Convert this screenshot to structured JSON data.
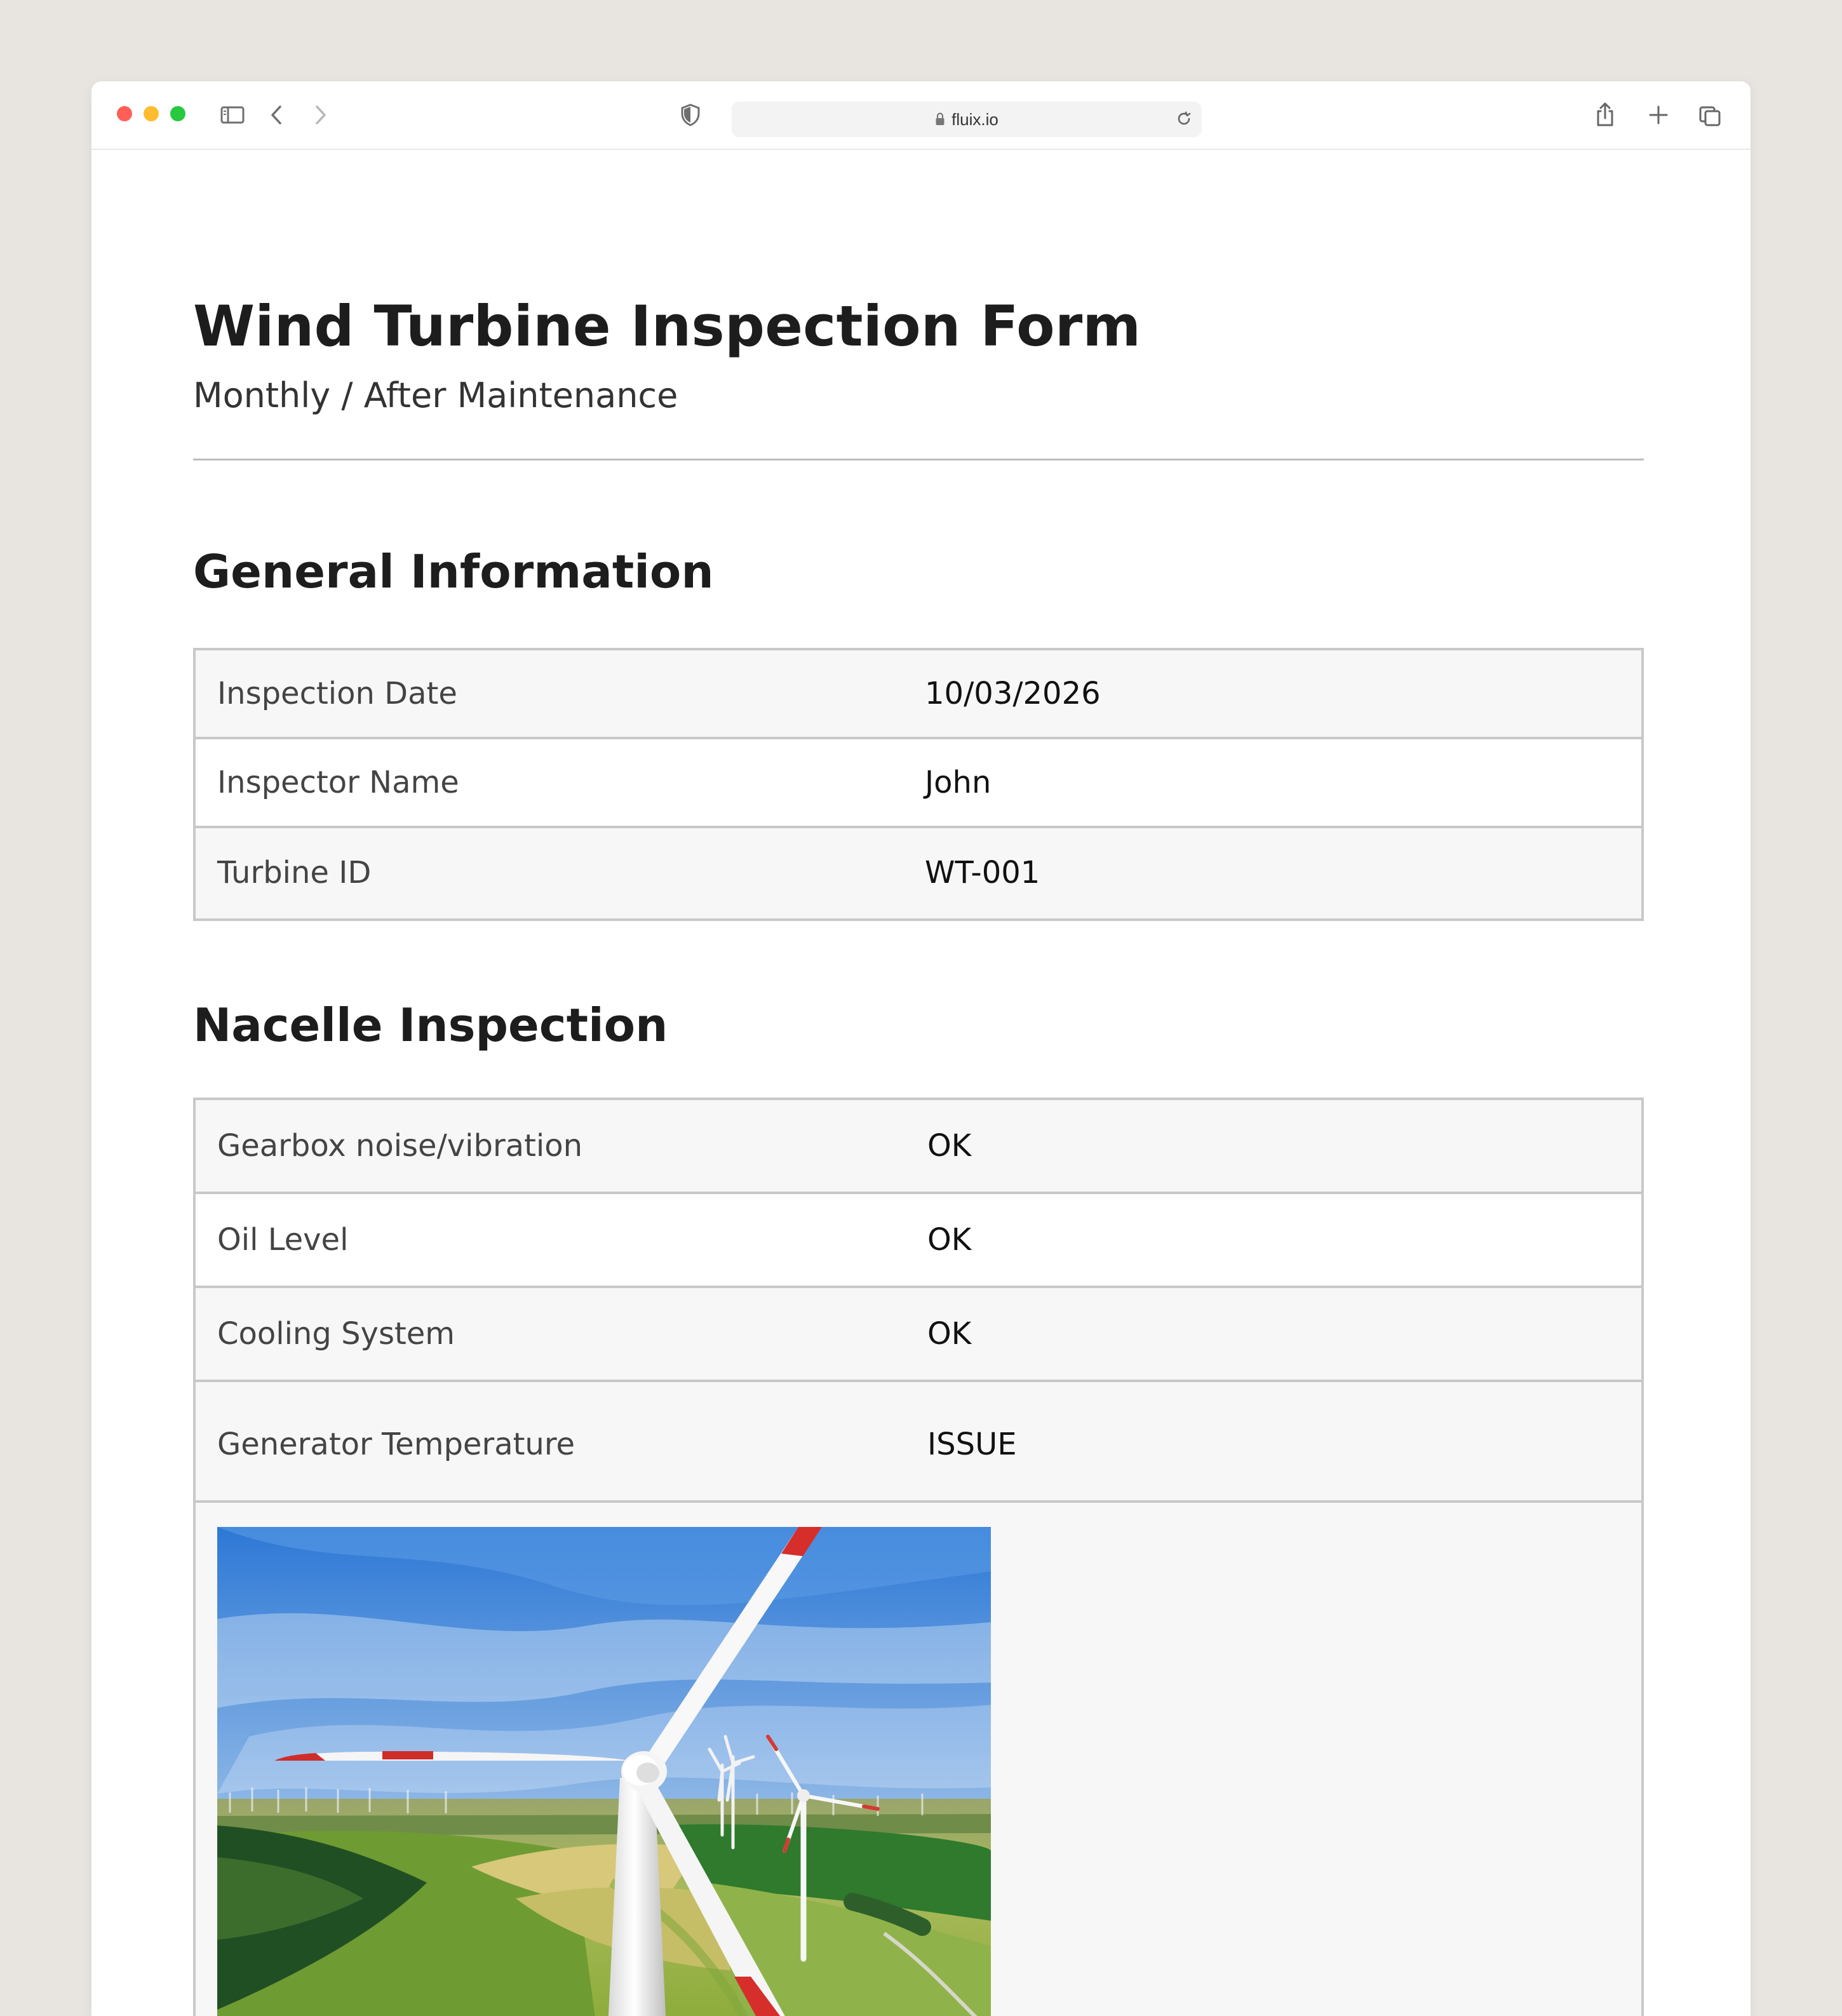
{
  "browser": {
    "url": "fluix.io",
    "icons": [
      "sidebar-icon",
      "back-arrow-icon",
      "forward-arrow-icon",
      "shield-icon",
      "lock-icon",
      "reload-icon",
      "share-icon",
      "plus-icon",
      "tabs-icon"
    ]
  },
  "page": {
    "title": "Wind Turbine Inspection Form",
    "subtitle": "Monthly / After Maintenance"
  },
  "sections": {
    "general": {
      "title": "General Information",
      "rows": [
        {
          "label": "Inspection Date",
          "value": "10/03/2026"
        },
        {
          "label": "Inspector Name",
          "value": "John"
        },
        {
          "label": "Turbine ID",
          "value": "WT-001"
        }
      ]
    },
    "nacelle": {
      "title": "Nacelle Inspection",
      "rows": [
        {
          "label": "Gearbox noise/vibration",
          "value": "OK"
        },
        {
          "label": "Oil Level",
          "value": "OK"
        },
        {
          "label": "Cooling System",
          "value": "OK"
        },
        {
          "label": "Generator Temperature",
          "value": "ISSUE"
        }
      ],
      "photo": {
        "semantic": "wind-turbine-photo"
      }
    }
  },
  "colors": {
    "page_background": "#e8e5e0",
    "window_background": "#ffffff",
    "table_background": "#f7f7f7",
    "table_border": "#c8c8c8",
    "title_text": "#1d1d1d",
    "label_text": "#444444",
    "value_text": "#111111",
    "traffic_red": "#fe5f57",
    "traffic_yellow": "#febc2e",
    "traffic_green": "#28c840"
  }
}
